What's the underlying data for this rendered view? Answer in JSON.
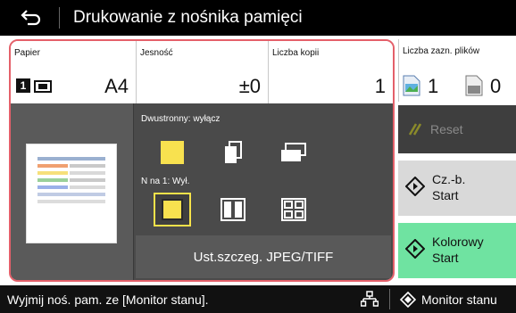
{
  "header": {
    "title": "Drukowanie z nośnika pamięci",
    "back_icon": "back-arrow-icon"
  },
  "settings": {
    "paper": {
      "label": "Papier",
      "tray_number": "1",
      "value": "A4"
    },
    "density": {
      "label": "Jesność",
      "value": "±0"
    },
    "copies": {
      "label": "Liczba kopii",
      "value": "1"
    }
  },
  "options": {
    "duplex_label": "Dwustronny: wyłącz",
    "n_on_1_label": "N na 1: Wył.",
    "jpeg_button": "Ust.szczeg. JPEG/TIFF"
  },
  "files": {
    "label": "Liczba zazn. plików",
    "jpeg_count": "1",
    "pdf_count": "0"
  },
  "actions": {
    "reset": "Reset",
    "bw_start": "Cz.-b.\nStart",
    "color_start": "Kolorowy\nStart"
  },
  "status": {
    "message": "Wyjmij noś. pam. ze [Monitor stanu].",
    "monitor_button": "Monitor stanu"
  },
  "colors": {
    "accent_frame": "#e4606a",
    "selected_border": "#f6e24a",
    "color_start": "#6fe3a1",
    "yellow_option": "#f8e14f"
  }
}
